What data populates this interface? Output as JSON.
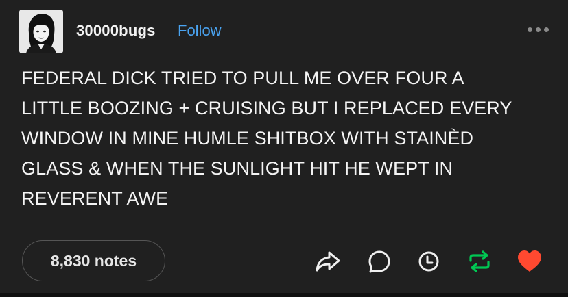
{
  "header": {
    "username": "30000bugs",
    "follow_label": "Follow",
    "more_icon": "more-icon"
  },
  "post": {
    "lines": [
      "FEDERAL DICK TRIED TO PULL ME OVER FOUR A",
      "LITTLE BOOZING + CRUISING BUT I REPLACED EVERY",
      "WINDOW IN MINE HUMLE SHITBOX WITH STAINÈD",
      "GLASS & WHEN THE SUNLIGHT HIT HE WEPT IN",
      "REVERENT AWE"
    ]
  },
  "footer": {
    "notes_label": "8,830 notes",
    "actions": [
      {
        "name": "share-icon",
        "color": "#f0f0f0"
      },
      {
        "name": "reply-icon",
        "color": "#f0f0f0"
      },
      {
        "name": "schedule-icon",
        "color": "#f0f0f0"
      },
      {
        "name": "reblog-icon",
        "color": "#00c853"
      },
      {
        "name": "like-icon",
        "color": "#ff4930"
      }
    ]
  },
  "colors": {
    "background": "#202020",
    "text": "#f4f4f4",
    "follow": "#4aa3f0",
    "reblog_active": "#00c853",
    "like_active": "#ff4930"
  }
}
